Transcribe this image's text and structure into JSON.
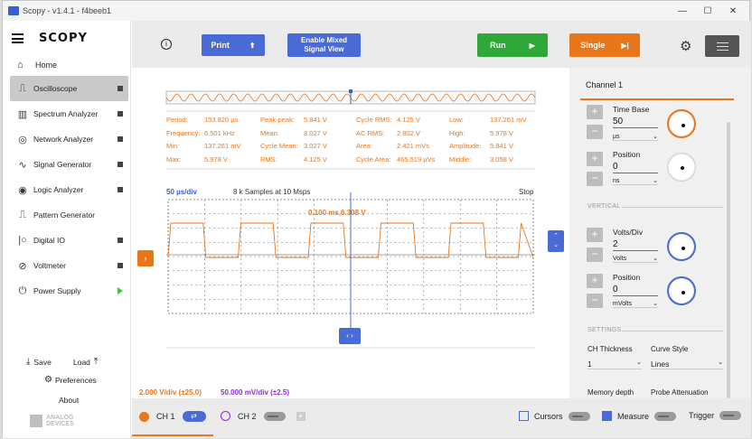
{
  "window": {
    "title": "Scopy - v1.4.1 - f4beeb1"
  },
  "sidebar": {
    "logo": "SCOPY",
    "home": "Home",
    "tools": [
      {
        "label": "Oscilloscope",
        "icon": "oscilloscope-icon",
        "active": true,
        "state": "stopped"
      },
      {
        "label": "Spectrum Analyzer",
        "icon": "spectrum-icon",
        "state": "stopped"
      },
      {
        "label": "Network Analyzer",
        "icon": "network-icon",
        "state": "stopped"
      },
      {
        "label": "Signal Generator",
        "icon": "signal-icon",
        "state": "stopped"
      },
      {
        "label": "Logic Analyzer",
        "icon": "logic-icon",
        "state": "stopped"
      },
      {
        "label": "Pattern Generator",
        "icon": "pattern-icon",
        "state": "stopped"
      },
      {
        "label": "Digital IO",
        "icon": "dio-icon",
        "state": "stopped"
      },
      {
        "label": "Voltmeter",
        "icon": "voltmeter-icon",
        "state": "stopped"
      },
      {
        "label": "Power Supply",
        "icon": "power-icon",
        "state": "running"
      }
    ],
    "save": "Save",
    "load": "Load",
    "preferences": "Preferences",
    "about": "About",
    "brand_line1": "ANALOG",
    "brand_line2": "DEVICES"
  },
  "toolbar": {
    "print": "Print",
    "mixed_line1": "Enable Mixed",
    "mixed_line2": "Signal View",
    "run": "Run",
    "single": "Single"
  },
  "measurements": [
    [
      {
        "k": "Period:",
        "v": "153.820 µs"
      },
      {
        "k": "Peak-peak:",
        "v": "5.841 V"
      },
      {
        "k": "Cycle RMS:",
        "v": "4.125 V"
      },
      {
        "k": "Low:",
        "v": "137.261 mV"
      }
    ],
    [
      {
        "k": "Frequency:",
        "v": "6.501 kHz"
      },
      {
        "k": "Mean:",
        "v": "3.027 V"
      },
      {
        "k": "AC RMS:",
        "v": "2.802 V"
      },
      {
        "k": "High:",
        "v": "5.978 V"
      }
    ],
    [
      {
        "k": "Min:",
        "v": "137.261 mV"
      },
      {
        "k": "Cycle Mean:",
        "v": "3.027 V"
      },
      {
        "k": "Area:",
        "v": "2.421 mVs"
      },
      {
        "k": "Amplitude:",
        "v": "5.841 V"
      }
    ],
    [
      {
        "k": "Max:",
        "v": "5.978 V"
      },
      {
        "k": "RMS:",
        "v": "4.125 V"
      },
      {
        "k": "Cycle Area:",
        "v": "465.519 µVs"
      },
      {
        "k": "Middle:",
        "v": "3.058 V"
      }
    ]
  ],
  "plot": {
    "timebase": "50 µs/div",
    "samples": "8 k Samples at 10 Msps",
    "status": "Stop",
    "marker": "0.100 ms,6.308 V",
    "ch1_scale": "2.000 V/div (±25.0)",
    "ch2_scale": "50.000 mV/div (±2.5)"
  },
  "channel_panel": {
    "title": "Channel 1",
    "timebase_label": "Time Base",
    "timebase_value": "50",
    "timebase_unit": "µs",
    "hpos_label": "Position",
    "hpos_value": "0",
    "hpos_unit": "ns",
    "vertical": "VERTICAL",
    "volts_label": "Volts/Div",
    "volts_value": "2",
    "volts_unit": "Volts",
    "vpos_label": "Position",
    "vpos_value": "0",
    "vpos_unit": "mVolts",
    "settings": "SETTINGS",
    "thickness_label": "CH Thickness",
    "thickness_value": "1",
    "curve_label": "Curve Style",
    "curve_value": "Lines",
    "memdepth_label": "Memory depth",
    "probe_label": "Probe Attenuation"
  },
  "bottom": {
    "ch1": "CH 1",
    "ch2": "CH 2",
    "cursors": "Cursors",
    "measure": "Measure",
    "trigger": "Trigger"
  },
  "colors": {
    "accent": "#e8761b",
    "blue": "#4a6ad6",
    "run": "#2fa83a",
    "ch2": "#8a2fd6"
  }
}
